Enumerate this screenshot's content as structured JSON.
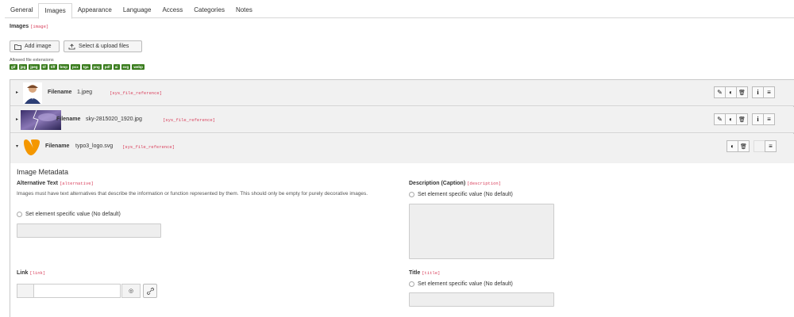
{
  "tabs": [
    {
      "label": "General"
    },
    {
      "label": "Images",
      "active": true
    },
    {
      "label": "Appearance"
    },
    {
      "label": "Language"
    },
    {
      "label": "Access"
    },
    {
      "label": "Categories"
    },
    {
      "label": "Notes"
    }
  ],
  "section": {
    "title": "Images",
    "tag": "[image]"
  },
  "buttons": {
    "add_image": "Add image",
    "select_upload": "Select & upload files"
  },
  "extensions": {
    "label": "Allowed file extensions",
    "items": [
      "gif",
      "jpg",
      "jpeg",
      "tif",
      "tiff",
      "bmp",
      "pcx",
      "tga",
      "png",
      "pdf",
      "ai",
      "svg",
      "webp"
    ]
  },
  "files": [
    {
      "label": "Filename",
      "name": "1.jpeg",
      "tag": "[sys_file_reference]",
      "icon": "user-avatar-thumbnail"
    },
    {
      "label": "Filename",
      "name": "sky-2815020_1920.jpg",
      "tag": "[sys_file_reference]",
      "icon": "sky-thumbnail"
    },
    {
      "label": "Filename",
      "name": "typo3_logo.svg",
      "tag": "[sys_file_reference]",
      "icon": "typo3-logo-thumbnail"
    }
  ],
  "action_icons": {
    "edit": "✎",
    "toggle": "◐",
    "delete": "🗑",
    "info": "i",
    "drag": "≡"
  },
  "metadata": {
    "title": "Image Metadata",
    "alt": {
      "label": "Alternative Text",
      "tag": "[alternative]",
      "help": "Images must have text alternatives that describe the information or function represented by them. This should only be empty for purely decorative images.",
      "radio": "Set element specific value (No default)"
    },
    "description": {
      "label": "Description (Caption)",
      "tag": "[description]",
      "radio": "Set element specific value (No default)"
    },
    "link": {
      "label": "Link",
      "tag": "[link]"
    },
    "title_field": {
      "label": "Title",
      "tag": "[title]",
      "radio": "Set element specific value (No default)"
    }
  }
}
